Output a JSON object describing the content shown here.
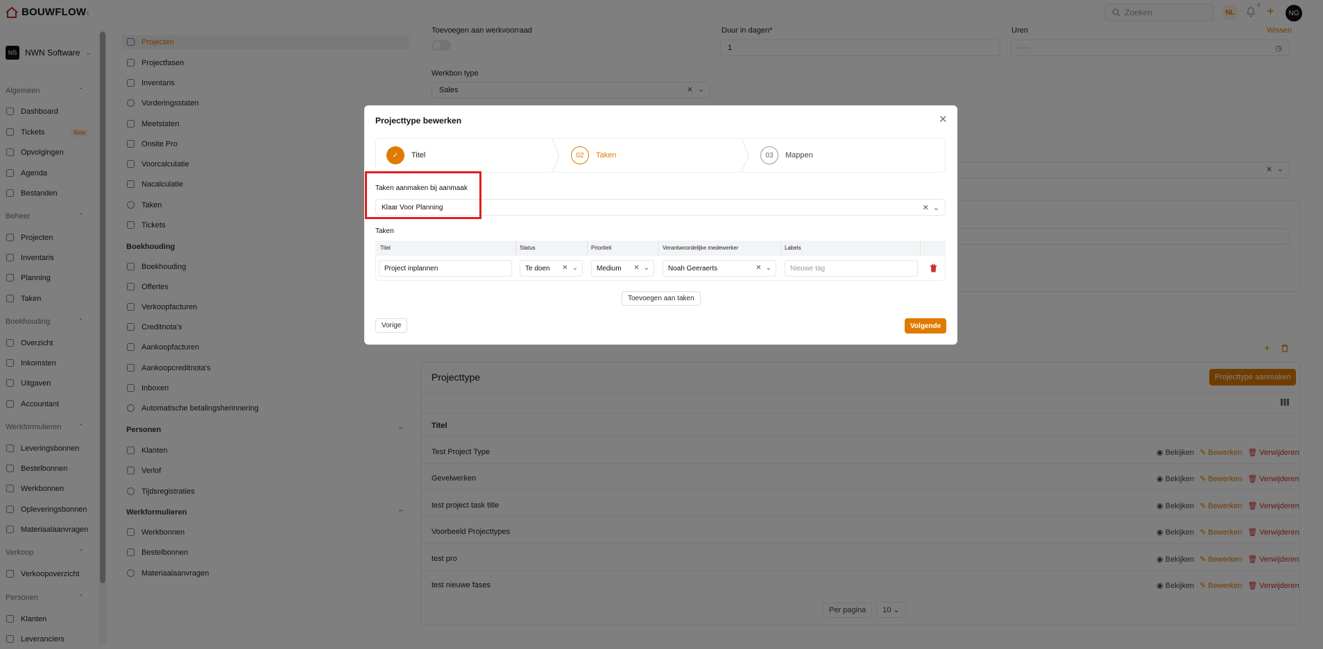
{
  "app": {
    "name": "BOUWFLOW"
  },
  "header": {
    "search_placeholder": "Zoeken",
    "lang": "NL",
    "notif_count": "4",
    "user_initials": "NG"
  },
  "org": {
    "initials": "NS",
    "name": "NWN Software"
  },
  "sidebar": {
    "sections": [
      {
        "title": "Algemeen",
        "items": [
          {
            "label": "Dashboard",
            "icon": "home-icon"
          },
          {
            "label": "Tickets",
            "icon": "ticket-icon",
            "badge": "Beta"
          },
          {
            "label": "Opvolgingen",
            "icon": "target-icon"
          },
          {
            "label": "Agenda",
            "icon": "calendar-icon"
          },
          {
            "label": "Bestanden",
            "icon": "folder-icon"
          }
        ]
      },
      {
        "title": "Beheer",
        "items": [
          {
            "label": "Projecten",
            "icon": "folder-icon"
          },
          {
            "label": "Inventaris",
            "icon": "archive-icon"
          },
          {
            "label": "Planning",
            "icon": "planning-icon"
          },
          {
            "label": "Taken",
            "icon": "check-circle-icon"
          }
        ]
      },
      {
        "title": "Boekhouding",
        "items": [
          {
            "label": "Overzicht",
            "icon": "bar-chart-icon"
          },
          {
            "label": "Inkomsten",
            "icon": "download-icon"
          },
          {
            "label": "Uitgaven",
            "icon": "upload-icon"
          },
          {
            "label": "Accountant",
            "icon": "briefcase-icon"
          }
        ]
      },
      {
        "title": "Werkformulieren",
        "items": [
          {
            "label": "Leveringsbonnen",
            "icon": "send-icon"
          },
          {
            "label": "Bestelbonnen",
            "icon": "cart-icon"
          },
          {
            "label": "Werkbonnen",
            "icon": "clipboard-icon"
          },
          {
            "label": "Opleveringsbonnen",
            "icon": "pen-icon"
          },
          {
            "label": "Materiaalaanvragen",
            "icon": "help-circle-icon"
          }
        ]
      },
      {
        "title": "Verkoop",
        "items": [
          {
            "label": "Verkoopoverzicht",
            "icon": "trend-icon"
          }
        ]
      },
      {
        "title": "Personen",
        "items": [
          {
            "label": "Klanten",
            "icon": "users-icon"
          },
          {
            "label": "Leveranciers",
            "icon": "truck-icon"
          }
        ]
      }
    ]
  },
  "subnav": {
    "items_top": [
      "Projecten",
      "Projectfasen",
      "Inventaris",
      "Vorderingsstaten",
      "Meetstaten",
      "Onsite Pro",
      "Voorcalculatie",
      "Nacalculatie",
      "Taken",
      "Tickets"
    ],
    "boekhouding_title": "Boekhouding",
    "boekhouding_items": [
      "Boekhouding",
      "Offertes",
      "Verkoopfacturen",
      "Creditnota's",
      "Aankoopfacturen",
      "Aankoopcreditnota's",
      "Inboxen",
      "Automatische betalingsherinnering"
    ],
    "personen_title": "Personen",
    "personen_items": [
      "Klanten",
      "Verlof",
      "Tijdsregistraties"
    ],
    "werk_title": "Werkformulieren",
    "werk_items": [
      "Werkbonnen",
      "Bestelbonnen",
      "Materiaalaanvragen"
    ]
  },
  "form": {
    "toevoegen_label": "Toevoegen aan werkvoorraad",
    "duur_label": "Duur in dagen*",
    "duur_value": "1",
    "uren_label": "Uren",
    "uren_placeholder": "--:--",
    "wissen": "Wissen",
    "werkbon_label": "Werkbon type",
    "werkbon_value": "Sales"
  },
  "projecttype": {
    "title": "Projecttype",
    "create_button": "Projecttype aanmaken",
    "column_title": "Titel",
    "rows": [
      "Test Project Type",
      "Gevelwerken",
      "test project task title",
      "Voorbeeld Projecttypes",
      "test pro",
      "test nieuwe fases"
    ],
    "view": "Bekijken",
    "edit": "Bewerken",
    "delete": "Verwijderen",
    "per_page_label": "Per pagina",
    "per_page_value": "10"
  },
  "modal": {
    "title": "Projecttype bewerken",
    "steps": [
      {
        "num": "",
        "label": "Titel",
        "state": "done"
      },
      {
        "num": "02",
        "label": "Taken",
        "state": "current"
      },
      {
        "num": "03",
        "label": "Mappen",
        "state": "next"
      }
    ],
    "create_label": "Taken aanmaken bij aanmaak",
    "create_value": "Klaar Voor Planning",
    "tasks_label": "Taken",
    "columns": [
      "Titel",
      "Status",
      "Prioriteit",
      "Verantwoordelijke medewerker",
      "Labels"
    ],
    "task": {
      "title": "Project inplannen",
      "status": "Te doen",
      "priority": "Medium",
      "assignee": "Noah Geeraerts",
      "labels_placeholder": "Nieuwe tag"
    },
    "add_button": "Toevoegen aan taken",
    "prev_button": "Vorige",
    "next_button": "Volgende"
  },
  "colors": {
    "accent": "#e07b00",
    "danger": "#d32f2f",
    "highlight": "#e01e1e"
  }
}
